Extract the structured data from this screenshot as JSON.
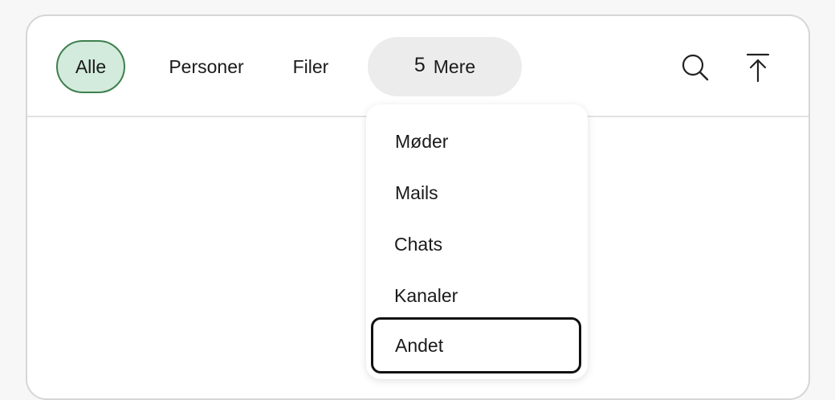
{
  "tabs": {
    "all": "Alle",
    "people": "Personer",
    "files": "Filer",
    "more_count": "5",
    "more_label": "Mere"
  },
  "icons": {
    "search": "search-icon",
    "back_to_top": "arrow-up-to-top-icon"
  },
  "menu": {
    "items": [
      "Møder",
      "Mails",
      "Chats",
      "Kanaler",
      "Andet"
    ],
    "focused_index": 4
  },
  "colors": {
    "active_tab_bg": "#d3ebdc",
    "active_tab_border": "#3f7f4f",
    "more_bg": "#ececec",
    "focus_outline": "#111111"
  }
}
